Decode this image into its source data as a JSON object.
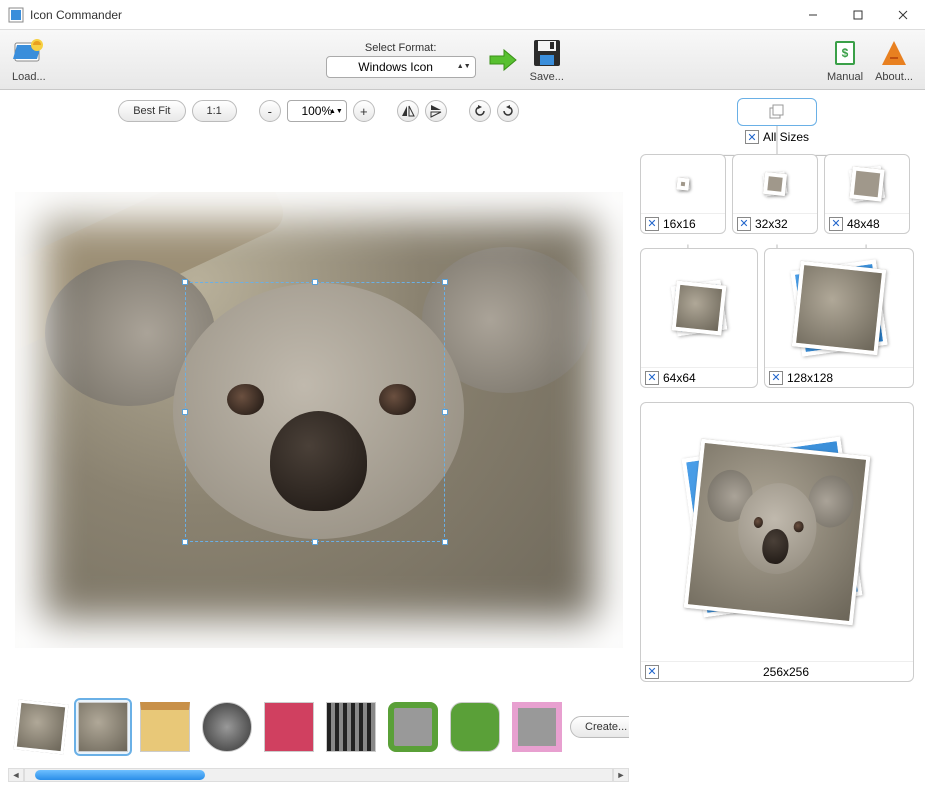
{
  "window": {
    "title": "Icon Commander"
  },
  "toolbar": {
    "load": "Load...",
    "format_title": "Select Format:",
    "format_value": "Windows Icon",
    "save": "Save...",
    "manual": "Manual",
    "about": "About..."
  },
  "viewbar": {
    "best_fit": "Best Fit",
    "one_to_one": "1:1",
    "minus": "-",
    "zoom_value": "100%",
    "plus": "+"
  },
  "thumbstrip": {
    "create": "Create..."
  },
  "sizes": {
    "all": "All Sizes",
    "s16": "16x16",
    "s32": "32x32",
    "s48": "48x48",
    "s64": "64x64",
    "s128": "128x128",
    "s256": "256x256"
  }
}
